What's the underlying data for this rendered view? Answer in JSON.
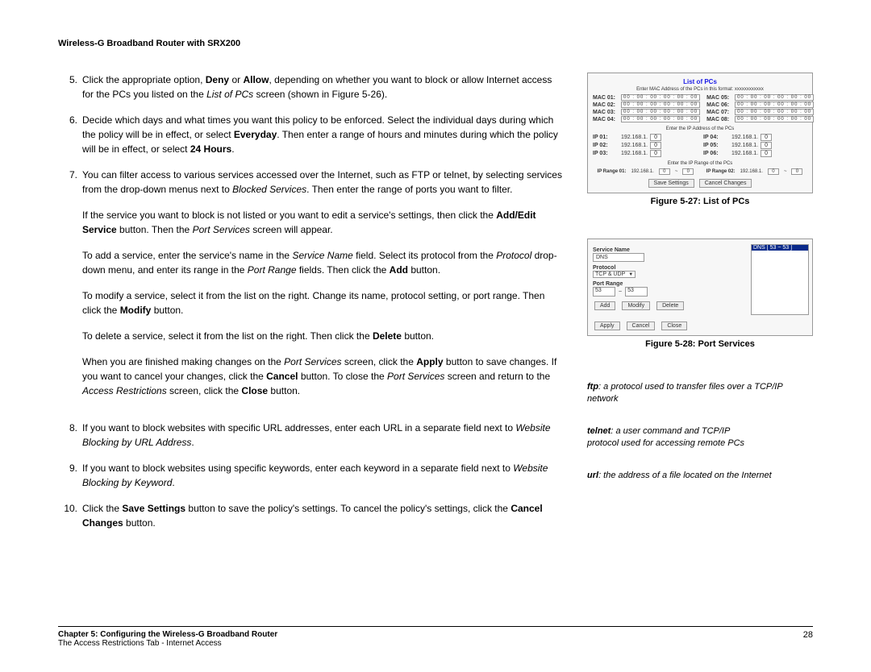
{
  "header": {
    "title": "Wireless-G Broadband Router with SRX200"
  },
  "steps": {
    "s5": {
      "num": "5.",
      "t1": "Click the appropriate option, ",
      "b1": "Deny",
      "t2": " or ",
      "b2": "Allow",
      "t3": ", depending on whether you want to block or allow Internet access for the PCs you listed on the ",
      "i1": "List of PCs",
      "t4": " screen (shown in Figure 5-26)."
    },
    "s6": {
      "num": "6.",
      "t1": "Decide which days and what times you want this policy to be enforced. Select the individual days during which the policy will be in effect, or select ",
      "b1": "Everyday",
      "t2": ". Then enter a range of hours and minutes during which the policy will be in effect, or select ",
      "b2": "24 Hours",
      "t3": "."
    },
    "s7": {
      "num": "7.",
      "t1": "You can filter access to various services accessed over the Internet, such as FTP or telnet, by selecting services from the drop-down menus next to ",
      "i1": "Blocked Services",
      "t2": ". Then enter the range of ports you want to filter."
    },
    "s7p2": {
      "t1": "If the service you want to block is not listed or you want to edit a service's settings, then click the ",
      "b1": "Add/Edit Service",
      "t2": " button. Then the ",
      "i1": "Port Services",
      "t3": " screen will appear."
    },
    "s7p3": {
      "t1": "To add a service, enter the service's name in the ",
      "i1": "Service Name",
      "t2": " field. Select its protocol from the ",
      "i2": "Protocol",
      "t3": " drop-down menu, and enter its range in the ",
      "i3": "Port Range",
      "t4": " fields. Then click the ",
      "b1": "Add",
      "t5": " button."
    },
    "s7p4": {
      "t1": "To modify a service, select it from the list on the right. Change its name, protocol setting, or port range. Then click the ",
      "b1": "Modify",
      "t2": " button."
    },
    "s7p5": {
      "t1": "To delete a service, select it from the list on the right. Then click the ",
      "b1": "Delete",
      "t2": " button."
    },
    "s7p6": {
      "t1": "When you are finished making changes on the ",
      "i1": "Port Services",
      "t2": " screen, click the ",
      "b1": "Apply",
      "t3": " button to save changes. If you want to cancel your changes, click the ",
      "b2": "Cancel",
      "t4": " button. To close the ",
      "i2": "Port Services",
      "t5": " screen and return to the ",
      "i3": "Access Restrictions",
      "t6": " screen, click the ",
      "b3": "Close",
      "t7": " button."
    },
    "s8": {
      "num": "8.",
      "t1": "If you want to block websites with specific URL addresses, enter each URL in a separate field next to ",
      "i1": "Website Blocking by URL Address",
      "t2": "."
    },
    "s9": {
      "num": "9.",
      "t1": "If you want to block websites using specific keywords, enter each keyword in a separate field next to ",
      "i1": "Website Blocking by Keyword",
      "t2": "."
    },
    "s10": {
      "num": "10.",
      "t1": "Click the ",
      "b1": "Save Settings",
      "t2": " button to save the policy's settings. To cancel the policy's settings, click the ",
      "b2": "Cancel Changes",
      "t3": " button."
    }
  },
  "fig27": {
    "caption": "Figure 5-27: List of PCs",
    "title": "List of PCs",
    "sub_mac": "Enter MAC Address of the PCs in this format: xxxxxxxxxxxx",
    "sub_ip": "Enter the IP Address of the PCs",
    "sub_range": "Enter the IP Range of the PCs",
    "mac_val": "00 : 00 : 00 : 00 : 00 : 00",
    "mac_labels": [
      "MAC 01:",
      "MAC 02:",
      "MAC 03:",
      "MAC 04:",
      "MAC 05:",
      "MAC 06:",
      "MAC 07:",
      "MAC 08:"
    ],
    "ip_labels": [
      "IP 01:",
      "IP 02:",
      "IP 03:",
      "IP 04:",
      "IP 05:",
      "IP 06:"
    ],
    "ip_prefix": "192.168.1.",
    "ip_last": "0",
    "range_label1": "IP Range 01:",
    "range_label2": "IP Range 02:",
    "range_sep": "~",
    "save": "Save Settings",
    "cancel": "Cancel Changes"
  },
  "fig28": {
    "caption": "Figure 5-28: Port Services",
    "service_name_label": "Service Name",
    "service_name_value": "DNS",
    "protocol_label": "Protocol",
    "protocol_value": "TCP & UDP",
    "port_range_label": "Port Range",
    "port_from": "53",
    "port_to": "53",
    "port_dash": "~",
    "selected_item": "DNS [ 53 ~ 53 ]",
    "btn_add": "Add",
    "btn_modify": "Modify",
    "btn_delete": "Delete",
    "btn_apply": "Apply",
    "btn_cancel": "Cancel",
    "btn_close": "Close"
  },
  "glossary": {
    "ftp": {
      "term": "ftp",
      "def": ": a protocol used to transfer files over a TCP/IP network"
    },
    "telnet": {
      "term": "telnet",
      "def_line1": ": a user command and TCP/IP",
      "def_line2": "protocol used for accessing remote PCs"
    },
    "url": {
      "term": "url",
      "def": ": the address of a file located on the Internet"
    }
  },
  "footer": {
    "chapter": "Chapter 5: Configuring the Wireless-G Broadband Router",
    "section": "The Access Restrictions Tab - Internet Access",
    "page": "28"
  }
}
